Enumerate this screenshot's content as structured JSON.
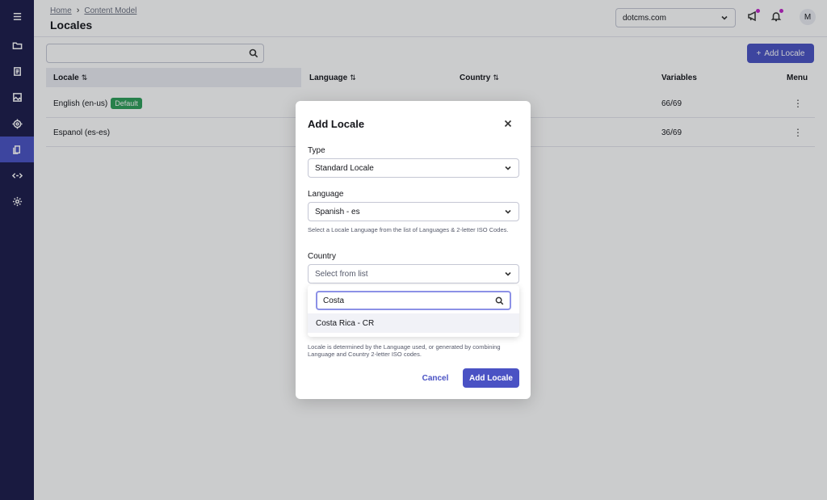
{
  "header": {
    "breadcrumb": [
      "Home",
      "Content Model"
    ],
    "title": "Locales",
    "site": "dotcms.com",
    "avatar": "M"
  },
  "toolbar": {
    "search_placeholder": "",
    "add_label": "Add Locale"
  },
  "table": {
    "columns": [
      "Locale",
      "Language",
      "Country",
      "Variables",
      "Menu"
    ],
    "rows": [
      {
        "locale": "English (en-us)",
        "badge": "Default",
        "variables": "66/69"
      },
      {
        "locale": "Espanol (es-es)",
        "badge": "",
        "variables": "36/69"
      }
    ]
  },
  "dialog": {
    "title": "Add Locale",
    "type_label": "Type",
    "type_value": "Standard Locale",
    "language_label": "Language",
    "language_value": "Spanish - es",
    "language_help": "Select a Locale Language from the list of Languages & 2-letter ISO Codes.",
    "country_label": "Country",
    "country_placeholder": "Select from list",
    "filter_value": "Costa",
    "option": "Costa Rica - CR",
    "footer_help": "Locale is determined by the Language used, or generated by combining Language and Country 2-letter ISO codes.",
    "cancel_label": "Cancel",
    "submit_label": "Add Locale"
  },
  "colors": {
    "sidebar_bg": "#1b1b4b",
    "primary": "#4a52c4",
    "badge": "#2e9e59",
    "notification_dot": "#c025c9"
  },
  "icons": [
    "menu-icon",
    "folder-icon",
    "document-icon",
    "image-icon",
    "target-icon",
    "pages-icon",
    "code-icon",
    "gear-icon",
    "search-icon",
    "chevron-down-icon",
    "megaphone-icon",
    "bell-icon",
    "close-icon",
    "plus-icon",
    "kebab-icon",
    "sort-icon"
  ]
}
